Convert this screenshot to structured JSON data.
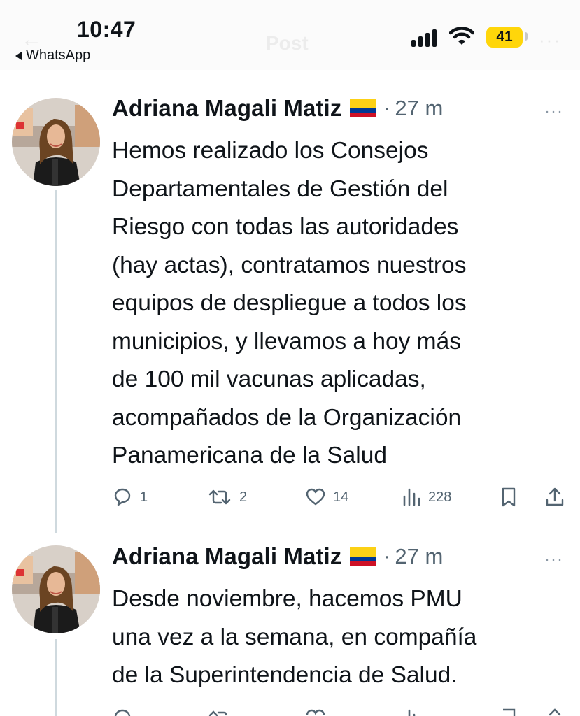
{
  "status_bar": {
    "time": "10:47",
    "back_app": "WhatsApp",
    "battery": "41",
    "ghost_title": "Post"
  },
  "tweets": [
    {
      "author": "Adriana Magali Matiz",
      "flag": "colombia-flag",
      "dot": "·",
      "time_ago": "27 m",
      "more": "···",
      "lines": [
        "Hemos realizado los Consejos",
        "Departamentales de Gestión del",
        "Riesgo con todas las autoridades",
        "(hay actas), contratamos nuestros",
        "equipos de despliegue a todos los",
        "municipios, y llevamos a hoy más",
        "de 100 mil vacunas aplicadas,",
        "acompañados de la Organización",
        "Panamericana de la Salud"
      ],
      "replies": "1",
      "reposts": "2",
      "likes": "14",
      "views": "228"
    },
    {
      "author": "Adriana Magali Matiz",
      "flag": "colombia-flag",
      "dot": "·",
      "time_ago": "27 m",
      "more": "···",
      "lines": [
        "Desde noviembre, hacemos PMU",
        "una vez a la semana, en compañía",
        "de la Superintendencia de Salud."
      ]
    }
  ],
  "colors": {
    "text": "#0f1419",
    "secondary": "#536471",
    "thread_line": "#cfd9de",
    "battery": "#ffd60a",
    "flag_yellow": "#fcd116",
    "flag_blue": "#003893",
    "flag_red": "#ce1126"
  },
  "icons": [
    "reply-icon",
    "repost-icon",
    "like-icon",
    "views-icon",
    "bookmark-icon",
    "share-icon",
    "more-icon",
    "signal-icon",
    "wifi-icon"
  ]
}
